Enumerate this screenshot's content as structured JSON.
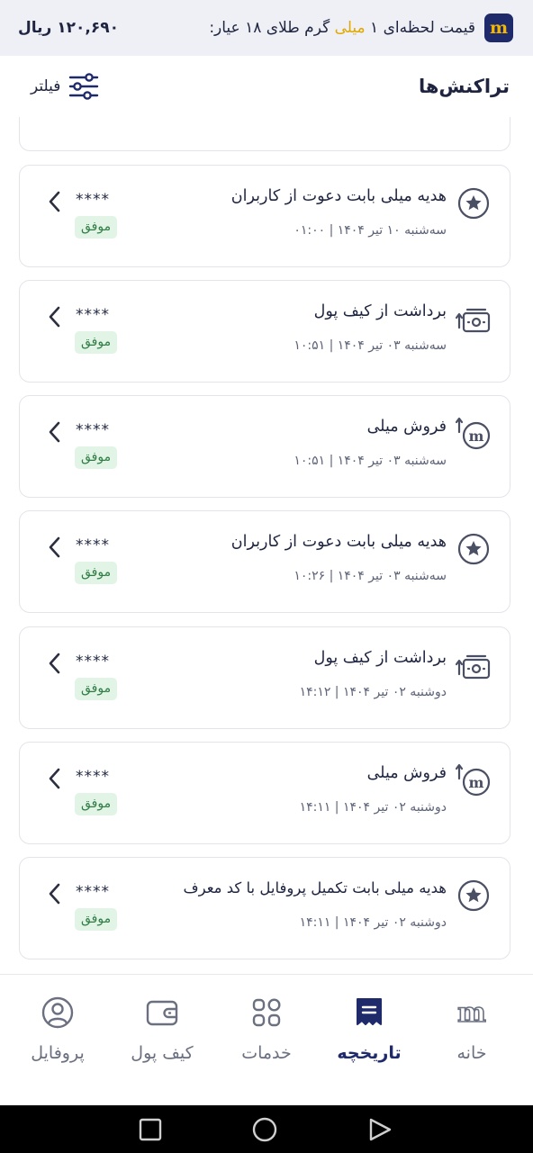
{
  "banner": {
    "text_before": "قیمت لحظه‌ای ۱",
    "text_highlight": "میلی",
    "text_after": "گرم طلای ۱۸ عیار:",
    "price": "۱۲۰,۶۹۰ ریال",
    "logo_letter": "m"
  },
  "header": {
    "title": "تراکنش‌ها",
    "filter_label": "فیلتر"
  },
  "transactions": [
    {
      "icon": "star-gift-icon",
      "title": "هدیه میلی بابت دعوت از کاربران",
      "date": "سه‌شنبه ۱۰ تیر ۱۴۰۴ | ۰۱:۰۰",
      "amount": "****",
      "status": "موفق"
    },
    {
      "icon": "wallet-withdraw-icon",
      "title": "برداشت از کیف پول",
      "date": "سه‌شنبه ۰۳ تیر ۱۴۰۴ | ۱۰:۵۱",
      "amount": "****",
      "status": "موفق"
    },
    {
      "icon": "sell-meli-icon",
      "title": "فروش میلی",
      "date": "سه‌شنبه ۰۳ تیر ۱۴۰۴ | ۱۰:۵۱",
      "amount": "****",
      "status": "موفق"
    },
    {
      "icon": "star-gift-icon",
      "title": "هدیه میلی بابت دعوت از کاربران",
      "date": "سه‌شنبه ۰۳ تیر ۱۴۰۴ | ۱۰:۲۶",
      "amount": "****",
      "status": "موفق"
    },
    {
      "icon": "wallet-withdraw-icon",
      "title": "برداشت از کیف پول",
      "date": "دوشنبه ۰۲ تیر ۱۴۰۴ | ۱۴:۱۲",
      "amount": "****",
      "status": "موفق"
    },
    {
      "icon": "sell-meli-icon",
      "title": "فروش میلی",
      "date": "دوشنبه ۰۲ تیر ۱۴۰۴ | ۱۴:۱۱",
      "amount": "****",
      "status": "موفق"
    },
    {
      "icon": "star-gift-icon",
      "title": "هدیه میلی بابت تکمیل پروفایل با کد معرف",
      "date": "دوشنبه ۰۲ تیر ۱۴۰۴ | ۱۴:۱۱",
      "amount": "****",
      "status": "موفق"
    }
  ],
  "bottom_nav": {
    "items": [
      {
        "label": "خانه",
        "icon": "home-m-icon",
        "active": false
      },
      {
        "label": "تاریخچه",
        "icon": "history-icon",
        "active": true
      },
      {
        "label": "خدمات",
        "icon": "services-grid-icon",
        "active": false
      },
      {
        "label": "کیف پول",
        "icon": "wallet-icon",
        "active": false
      },
      {
        "label": "پروفایل",
        "icon": "profile-icon",
        "active": false
      }
    ]
  },
  "colors": {
    "primary": "#1f2a6b",
    "accent_gold": "#f2b705",
    "success_bg": "#e2f4e6",
    "success_text": "#2f7d44"
  }
}
